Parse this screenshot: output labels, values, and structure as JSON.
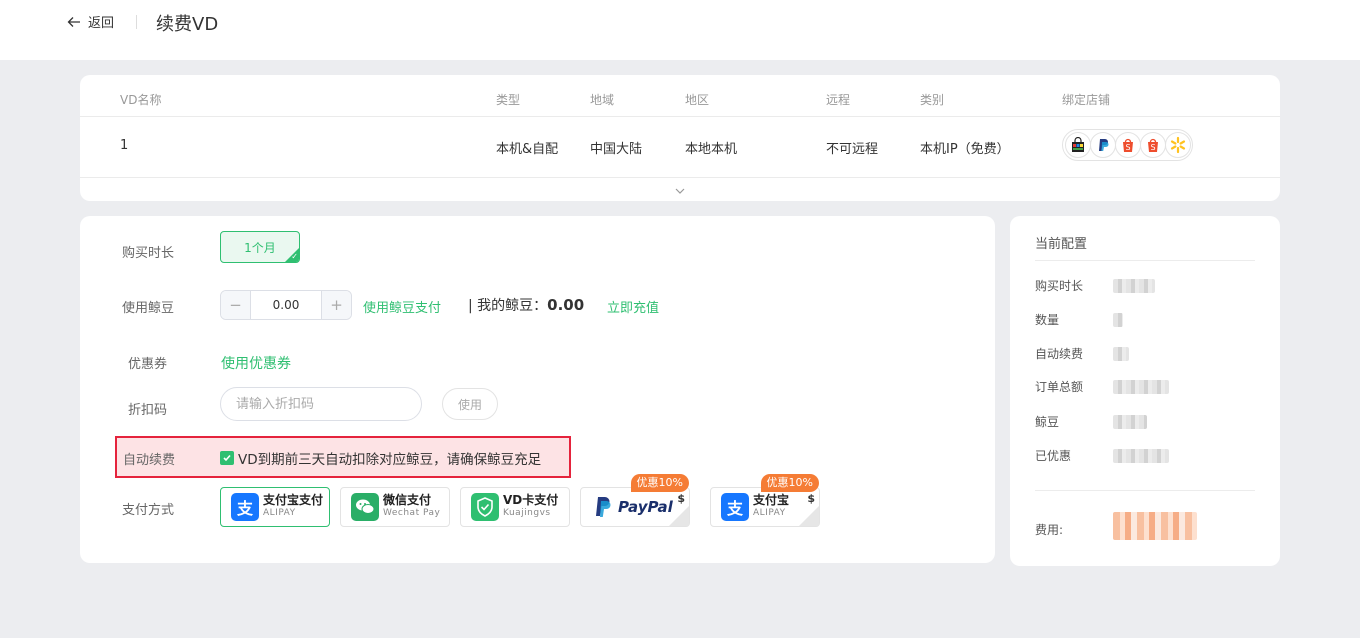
{
  "header": {
    "back_label": "返回",
    "title": "续费VD"
  },
  "vd_table": {
    "headers": {
      "name": "VD名称",
      "type": "类型",
      "territory": "地域",
      "region": "地区",
      "remote": "远程",
      "category": "类别",
      "stores": "绑定店铺"
    },
    "row": {
      "name": "1",
      "type": "本机&自配",
      "territory": "中国大陆",
      "region": "本地本机",
      "remote": "不可远程",
      "category": "本机IP（免费）"
    },
    "store_icons": [
      "shopping-bag-icon",
      "paypal-icon",
      "shopee-icon",
      "shopee-icon",
      "walmart-spark-icon"
    ]
  },
  "form": {
    "duration_label": "购买时长",
    "duration_value": "1个月",
    "bean_label": "使用鲸豆",
    "bean_value": "0.00",
    "bean_pay_link": "使用鲸豆支付",
    "my_beans_label": "| 我的鲸豆：",
    "my_beans_value": "0.00",
    "recharge_link": "立即充值",
    "coupon_label": "优惠券",
    "coupon_link": "使用优惠券",
    "discount_label": "折扣码",
    "discount_placeholder": "请输入折扣码",
    "discount_use": "使用",
    "auto_renew_label": "自动续费",
    "auto_renew_text": "VD到期前三天自动扣除对应鲸豆，请确保鲸豆充足",
    "auto_renew_checked": true,
    "payment_label": "支付方式"
  },
  "payments": [
    {
      "name": "支付宝支付",
      "sub": "ALIPAY",
      "icon": "alipay-icon",
      "color": "#1677ff",
      "badge": "",
      "selected": true
    },
    {
      "name": "微信支付",
      "sub": "Wechat Pay",
      "icon": "wechat-icon",
      "color": "#2aae67",
      "badge": "",
      "selected": false
    },
    {
      "name": "VD卡支付",
      "sub": "Kuajingvs",
      "icon": "shield-check-icon",
      "color": "#2fbf71",
      "badge": "",
      "selected": false
    },
    {
      "name": "PayPal",
      "sub": "",
      "icon": "paypal-icon",
      "color": "#253b80",
      "badge": "优惠10%",
      "selected": false
    },
    {
      "name": "支付宝",
      "sub": "ALIPAY",
      "icon": "alipay-icon",
      "color": "#1677ff",
      "badge": "优惠10%",
      "selected": false
    }
  ],
  "summary": {
    "title": "当前配置",
    "rows": [
      "购买时长",
      "数量",
      "自动续费",
      "订单总额",
      "鲸豆",
      "已优惠"
    ],
    "fee_label": "费用:"
  },
  "colors": {
    "accent": "#2fbf71",
    "highlight_border": "#e5233c",
    "badge": "#f57c35"
  }
}
